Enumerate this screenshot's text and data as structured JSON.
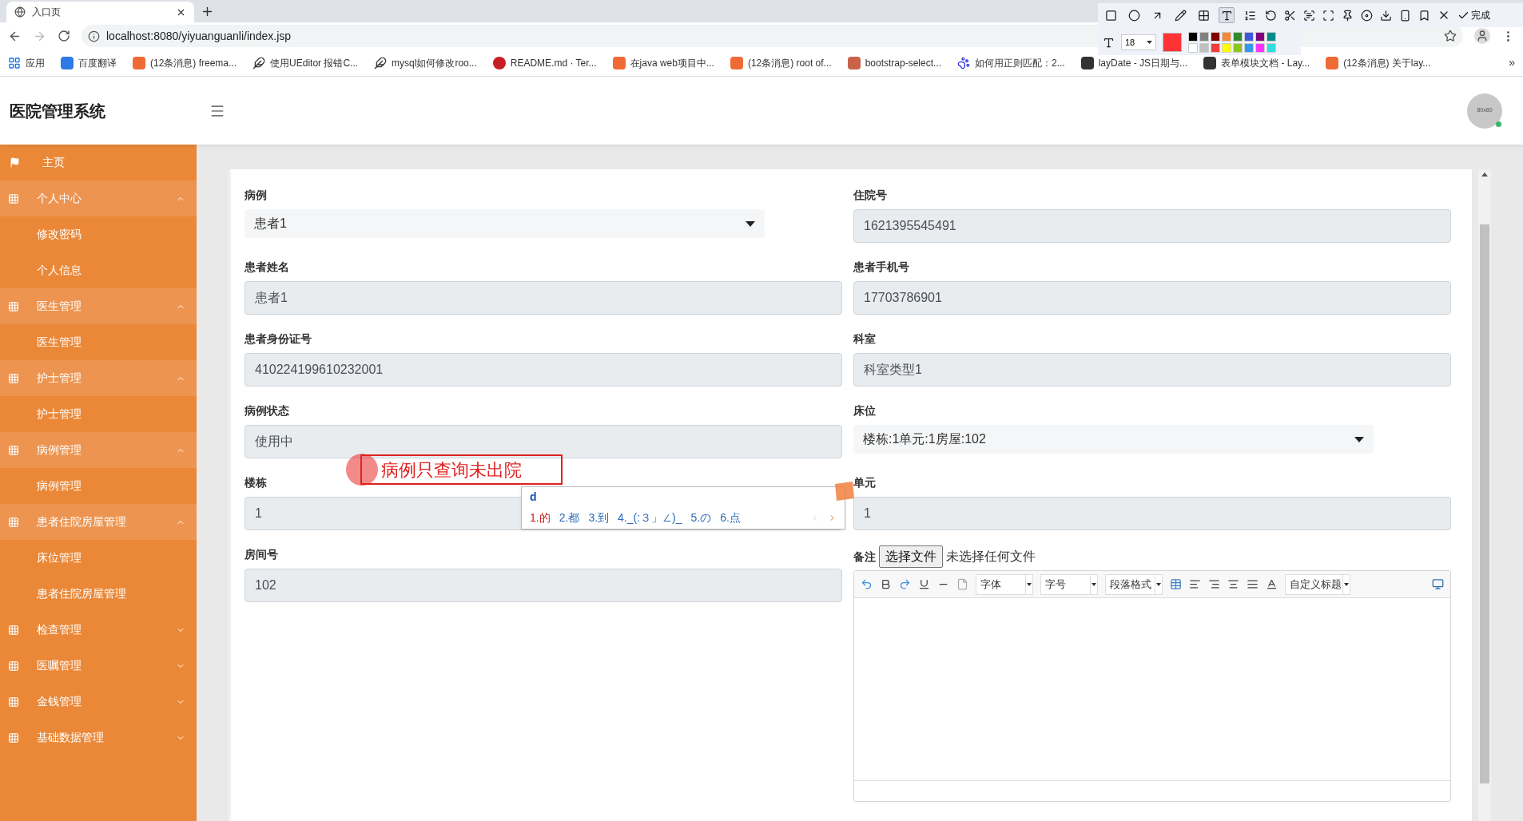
{
  "browser": {
    "tab": {
      "title": "入口页"
    },
    "url": "localhost:8080/yiyuanguanli/index.jsp",
    "bookmarks": [
      {
        "label": "应用",
        "kind": "apps"
      },
      {
        "label": "百度翻译",
        "kind": "badge",
        "color": "#2f7ae5"
      },
      {
        "label": "(12条消息) freema...",
        "kind": "badge",
        "color": "#f06a35"
      },
      {
        "label": "使用UEditor 报错C...",
        "kind": "quill"
      },
      {
        "label": "mysql如何修改roo...",
        "kind": "quill"
      },
      {
        "label": "README.md · Ter...",
        "kind": "round",
        "color": "#c71d23"
      },
      {
        "label": "在java web项目中...",
        "kind": "badge",
        "color": "#f06a35"
      },
      {
        "label": "(12条消息) root of...",
        "kind": "badge",
        "color": "#f06a35"
      },
      {
        "label": "bootstrap-select...",
        "kind": "badge",
        "color": "#c8624a"
      },
      {
        "label": "如何用正则匹配：2...",
        "kind": "paw"
      },
      {
        "label": "layDate - JS日期与...",
        "kind": "badge",
        "color": "#333333"
      },
      {
        "label": "表单模块文档 - Lay...",
        "kind": "badge",
        "color": "#333333"
      },
      {
        "label": "(12条消息) 关于lay...",
        "kind": "badge",
        "color": "#f06a35"
      }
    ],
    "more": "»"
  },
  "capture_toolbar": {
    "tools": [
      {
        "selected": false
      },
      {
        "selected": false
      },
      {
        "selected": false
      },
      {
        "selected": false
      },
      {
        "selected": false
      },
      {
        "selected": true
      },
      {
        "selected": false
      }
    ],
    "done": "完成",
    "font_size": "18",
    "current_swatch": {
      "color": "#ff3333"
    },
    "swatches": [
      {
        "color": "#000000"
      },
      {
        "color": "#808080"
      },
      {
        "color": "#800000"
      },
      {
        "color": "#f08a38"
      },
      {
        "color": "#2e8b2e"
      },
      {
        "color": "#3b5bdb"
      },
      {
        "color": "#800080"
      },
      {
        "color": "#008b8b"
      },
      {
        "color": "#ffffff"
      },
      {
        "color": "#c0c0c0"
      },
      {
        "color": "#f03c3c"
      },
      {
        "color": "#ffff00"
      },
      {
        "color": "#8fc31f"
      },
      {
        "color": "#3399ee"
      },
      {
        "color": "#ff33ff"
      },
      {
        "color": "#33dddd"
      }
    ]
  },
  "app": {
    "title": "医院管理系统",
    "avatar": "80x80"
  },
  "sidebar": {
    "items": [
      {
        "label": "主页",
        "kind": "home"
      },
      {
        "label": "个人中心",
        "kind": "group",
        "expanded": true,
        "children": [
          {
            "label": "修改密码"
          },
          {
            "label": "个人信息"
          }
        ]
      },
      {
        "label": "医生管理",
        "kind": "group",
        "expanded": true,
        "children": [
          {
            "label": "医生管理"
          }
        ]
      },
      {
        "label": "护士管理",
        "kind": "group",
        "expanded": true,
        "children": [
          {
            "label": "护士管理"
          }
        ]
      },
      {
        "label": "病例管理",
        "kind": "group",
        "expanded": true,
        "children": [
          {
            "label": "病例管理"
          }
        ]
      },
      {
        "label": "患者住院房屋管理",
        "kind": "group",
        "expanded": true,
        "children": [
          {
            "label": "床位管理"
          },
          {
            "label": "患者住院房屋管理"
          }
        ]
      },
      {
        "label": "检查管理",
        "kind": "group",
        "expanded": false
      },
      {
        "label": "医嘱管理",
        "kind": "group",
        "expanded": false
      },
      {
        "label": "金钱管理",
        "kind": "group",
        "expanded": false
      },
      {
        "label": "基础数据管理",
        "kind": "group",
        "expanded": false
      }
    ]
  },
  "form": {
    "fields": [
      {
        "label": "病例",
        "kind": "select",
        "value": "患者1"
      },
      {
        "label": "住院号",
        "kind": "readonly",
        "value": "1621395545491"
      },
      {
        "label": "患者姓名",
        "kind": "readonly",
        "value": "患者1"
      },
      {
        "label": "患者手机号",
        "kind": "readonly",
        "value": "17703786901"
      },
      {
        "label": "患者身份证号",
        "kind": "readonly",
        "value": "410224199610232001"
      },
      {
        "label": "科室",
        "kind": "readonly",
        "value": "科室类型1"
      },
      {
        "label": "病例状态",
        "kind": "readonly",
        "value": "使用中"
      },
      {
        "label": "床位",
        "kind": "select",
        "value": "楼栋:1单元:1房屋:102"
      },
      {
        "label": "楼栋",
        "kind": "readonly",
        "value": "1"
      },
      {
        "label": "单元",
        "kind": "readonly",
        "value": "1"
      },
      {
        "label": "房间号",
        "kind": "readonly",
        "value": "102"
      },
      {
        "label": "备注",
        "kind": "editor",
        "file_button": "选择文件",
        "file_status": "未选择任何文件",
        "dropdowns": [
          "字体",
          "字号",
          "段落格式",
          "自定义标题"
        ]
      }
    ]
  },
  "annotation": {
    "text": "病例只查询未出院"
  },
  "ime": {
    "input": "d",
    "candidates": [
      {
        "label": "1.的",
        "selected": true
      },
      {
        "label": "2.都",
        "selected": false
      },
      {
        "label": "3.到",
        "selected": false
      },
      {
        "label": "4._(:３」∠)_",
        "selected": false
      },
      {
        "label": "5.の",
        "selected": false
      },
      {
        "label": "6.点",
        "selected": false
      }
    ]
  }
}
